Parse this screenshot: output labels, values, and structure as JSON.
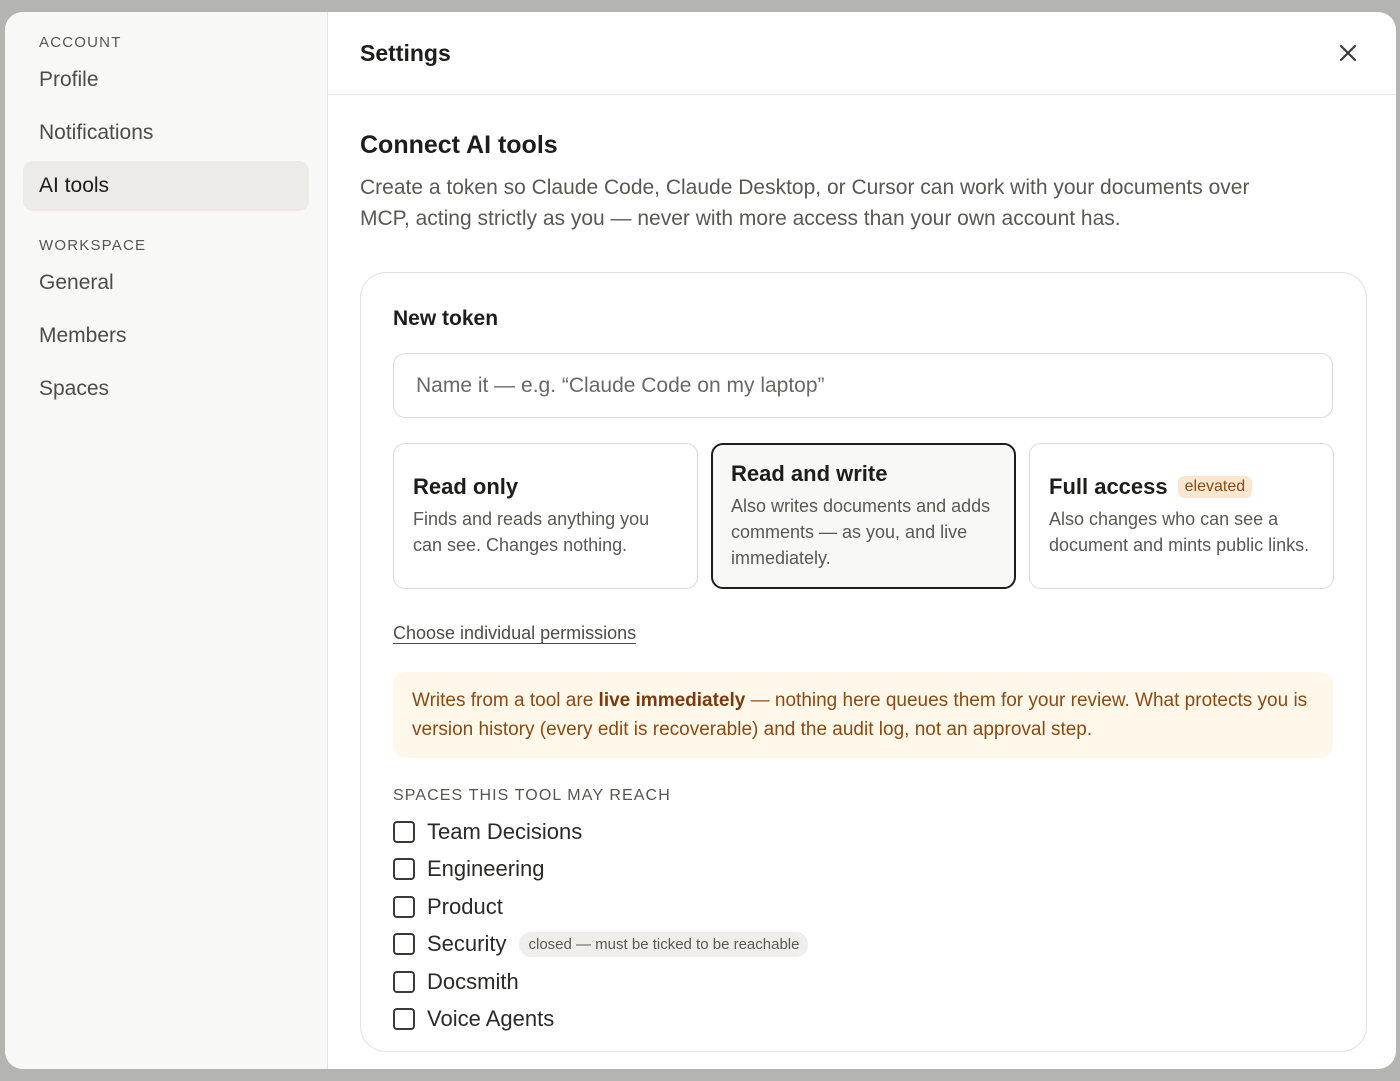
{
  "sidebar": {
    "account_heading": "ACCOUNT",
    "workspace_heading": "WORKSPACE",
    "account_items": [
      {
        "label": "Profile"
      },
      {
        "label": "Notifications"
      },
      {
        "label": "AI tools",
        "active": true
      }
    ],
    "workspace_items": [
      {
        "label": "General"
      },
      {
        "label": "Members"
      },
      {
        "label": "Spaces"
      }
    ]
  },
  "header": {
    "title": "Settings",
    "close_icon": "close-icon"
  },
  "main": {
    "title": "Connect AI tools",
    "description": "Create a token so Claude Code, Claude Desktop, or Cursor can work with your documents over MCP, acting strictly as you — never with more access than your own account has.",
    "card": {
      "title": "New token",
      "name_input": {
        "value": "",
        "placeholder": "Name it — e.g. “Claude Code on my laptop”"
      },
      "options": [
        {
          "title": "Read only",
          "desc": "Finds and reads anything you can see. Changes nothing.",
          "selected": false
        },
        {
          "title": "Read and write",
          "desc": "Also writes documents and adds comments — as you, and live immediately.",
          "selected": true
        },
        {
          "title": "Full access",
          "badge": "elevated",
          "desc": "Also changes who can see a document and mints public links.",
          "selected": false
        }
      ],
      "permissions_link": "Choose individual permissions",
      "warning": {
        "pre": "Writes from a tool are ",
        "bold": "live immediately",
        "post": " — nothing here queues them for your review. What protects you is version history (every edit is recoverable) and the audit log, not an approval step."
      },
      "spaces_heading": "SPACES THIS TOOL MAY REACH",
      "spaces": [
        {
          "label": "Team Decisions",
          "checked": false
        },
        {
          "label": "Engineering",
          "checked": false
        },
        {
          "label": "Product",
          "checked": false
        },
        {
          "label": "Security",
          "checked": false,
          "badge": "closed — must be ticked to be reachable"
        },
        {
          "label": "Docsmith",
          "checked": false
        },
        {
          "label": "Voice Agents",
          "checked": false
        }
      ]
    }
  },
  "colors": {
    "warning_bg": "#fdf8ea",
    "warning_text": "#8a4a14",
    "badge_bg": "#fbe7cf"
  }
}
